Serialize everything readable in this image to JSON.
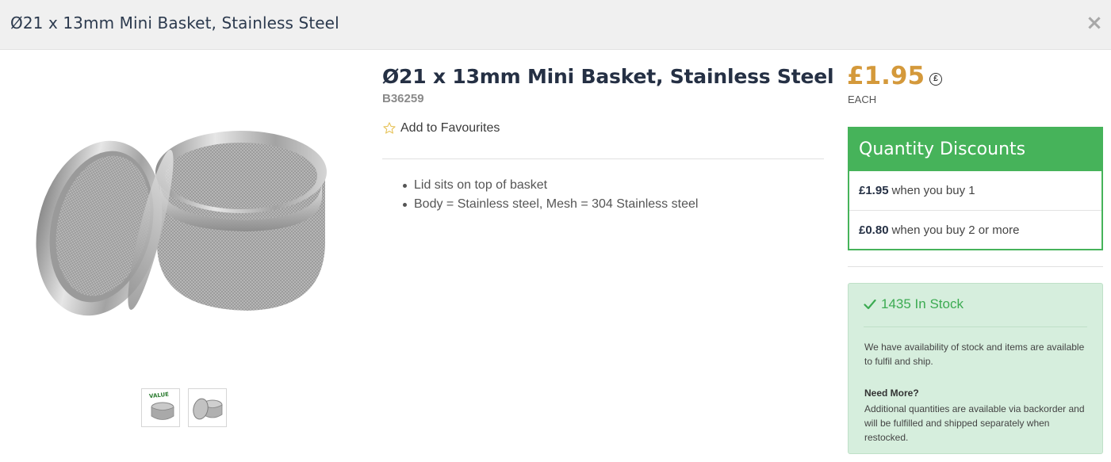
{
  "modal": {
    "title": "Ø21 x 13mm Mini Basket, Stainless Steel",
    "close_label": "×"
  },
  "product": {
    "title": "Ø21 x 13mm Mini Basket, Stainless Steel",
    "sku": "B36259",
    "favourite_label": "Add to Favourites",
    "features": [
      "Lid sits on top of basket",
      "Body = Stainless steel, Mesh = 304 Stainless steel"
    ],
    "thumbnails": [
      {
        "icon": "basket-value-thumbnail",
        "badge": "VALUE"
      },
      {
        "icon": "basket-thumbnail"
      }
    ]
  },
  "pricing": {
    "price": "£1.95",
    "currency_symbol": "£",
    "unit": "EACH",
    "price_color": "#d4993b"
  },
  "discounts": {
    "title": "Quantity Discounts",
    "accent": "#46b35a",
    "rows": [
      {
        "price": "£1.95",
        "text": "when you buy 1"
      },
      {
        "price": "£0.80",
        "text": "when you buy 2 or more"
      }
    ]
  },
  "stock": {
    "label": "1435 In Stock",
    "availability_text": "We have availability of stock and items are available to fulfil and ship.",
    "need_more_title": "Need More?",
    "need_more_text": "Additional quantities are available via backorder and will be fulfilled and shipped separately when restocked.",
    "accent": "#3cab52"
  }
}
